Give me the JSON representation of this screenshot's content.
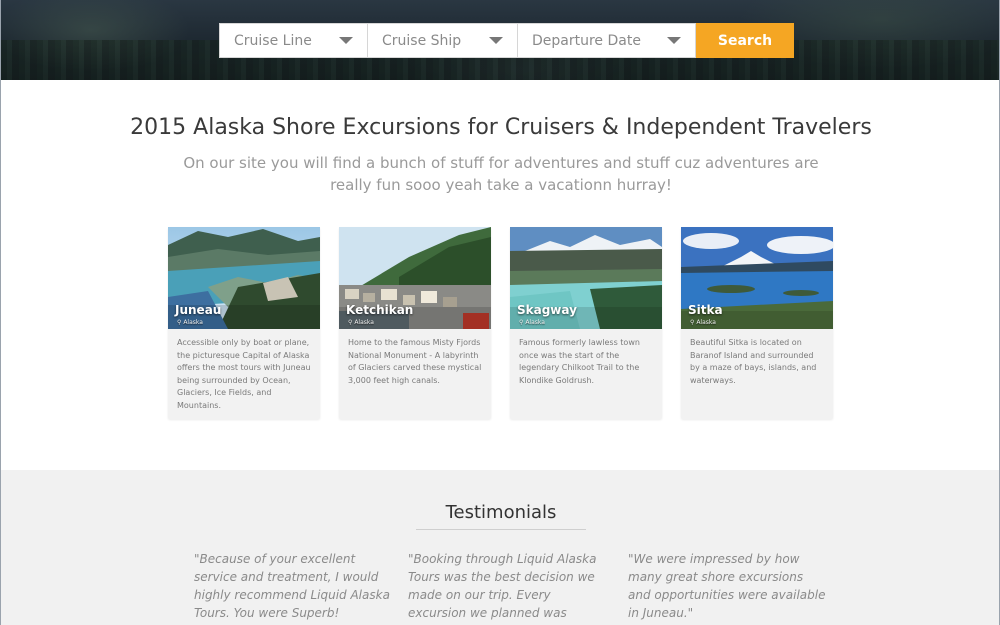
{
  "search": {
    "cruise_line": "Cruise Line",
    "cruise_ship": "Cruise Ship",
    "departure_date": "Departure Date",
    "button": "Search"
  },
  "intro": {
    "title": "2015 Alaska Shore Excursions for Cruisers & Independent Travelers",
    "subtitle": "On our site you will find a bunch of stuff for adventures and stuff cuz adventures are really fun sooo yeah take a vacationn hurray!"
  },
  "destinations": [
    {
      "name": "Juneau",
      "region": "Alaska",
      "description": "Accessible only by boat or plane, the picturesque Capital of Alaska offers the most tours with Juneau being surrounded by Ocean, Glaciers, Ice Fields, and Mountains."
    },
    {
      "name": "Ketchikan",
      "region": "Alaska",
      "description": "Home to the famous Misty Fjords National Monument -   A labyrinth of Glaciers carved these mystical 3,000 feet high canals."
    },
    {
      "name": "Skagway",
      "region": "Alaska",
      "description": "Famous formerly lawless town once was the start of the legendary Chilkoot Trail to the Klondike Goldrush."
    },
    {
      "name": "Sitka",
      "region": "Alaska",
      "description": "Beautiful Sitka is located on Baranof Island and surrounded by a maze of bays, islands, and waterways."
    }
  ],
  "testimonials": {
    "title": "Testimonials",
    "quotes": [
      "\"Because of your excellent service and treatment, I would highly recommend Liquid Alaska Tours. You were Superb!",
      "\"Booking through Liquid Alaska Tours was the best decision we made on our trip. Every excursion we planned was",
      "\"We were impressed by how many great shore excursions and opportunities were available in Juneau.\""
    ]
  },
  "colors": {
    "accent": "#f5a623",
    "hero": "#1f2a33",
    "testimonial_bg": "#f1f1f1"
  }
}
